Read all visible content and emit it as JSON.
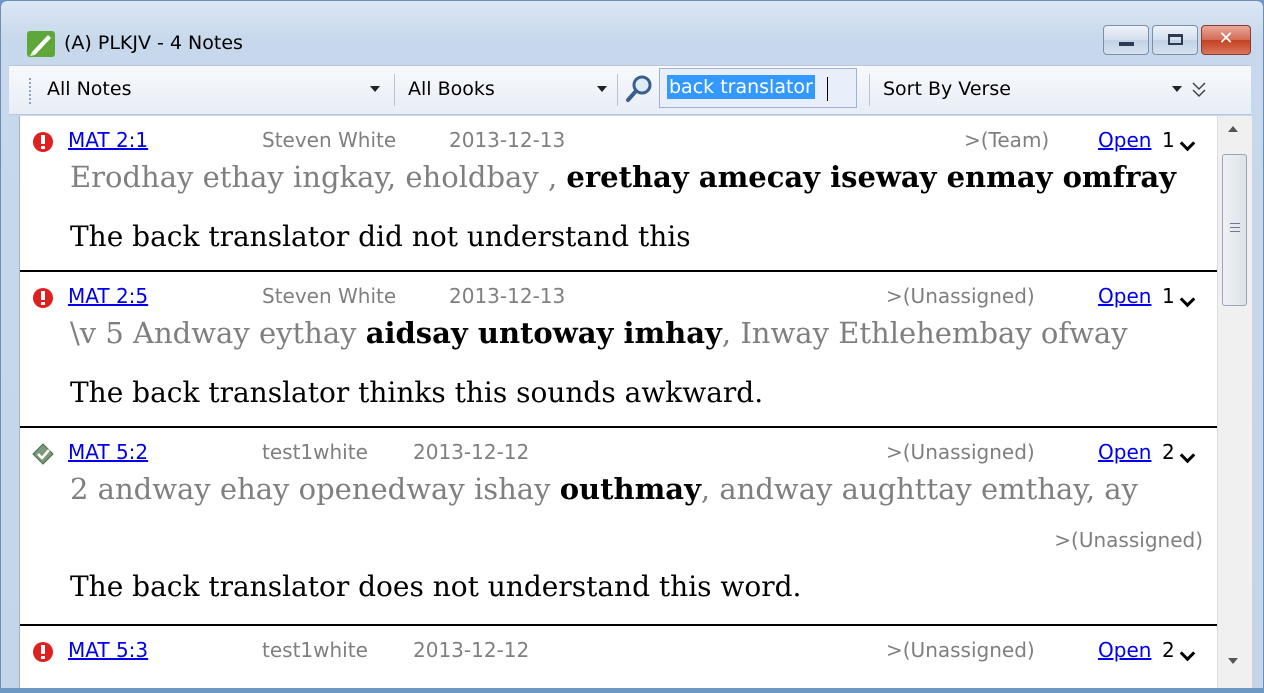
{
  "window": {
    "title": "(A) PLKJV - 4 Notes"
  },
  "toolbar": {
    "filter": "All Notes",
    "books": "All Books",
    "search_value": "back translator",
    "sort": "Sort By Verse"
  },
  "notes": [
    {
      "status": "alert",
      "ref": "MAT 2:1",
      "author": "Steven White",
      "date": "2013-12-13",
      "assigned": ">(Team)",
      "open": "Open",
      "count": "1",
      "verse_plain": "Erodhay ethay ingkay, eholdbay , ",
      "verse_bold": "erethay amecay iseway enmay omfray",
      "verse_after": "",
      "comment": "The back translator did not understand this"
    },
    {
      "status": "alert",
      "ref": "MAT 2:5",
      "author": "Steven White",
      "date": "2013-12-13",
      "assigned": ">(Unassigned)",
      "open": "Open",
      "count": "1",
      "verse_plain": "\\v 5 Andway eythay ",
      "verse_bold": "aidsay untoway imhay",
      "verse_after": ", Inway Ethlehembay ofway",
      "comment": "The back translator thinks this sounds awkward."
    },
    {
      "status": "resolved",
      "ref": "MAT 5:2",
      "author": "test1white",
      "date": "2013-12-12",
      "assigned": ">(Unassigned)",
      "open": "Open",
      "count": "2",
      "verse_plain": "2 andway ehay openedway ishay ",
      "verse_bold": "outhmay",
      "verse_after": ", andway aughttay emthay, ay",
      "sub_assigned": ">(Unassigned)",
      "comment": "The back translator does not understand this word."
    },
    {
      "status": "alert",
      "ref": "MAT 5:3",
      "author": "test1white",
      "date": "2013-12-12",
      "assigned": ">(Unassigned)",
      "open": "Open",
      "count": "2"
    }
  ],
  "icons": {
    "app": "pencil-leaf-icon",
    "alert": "exclamation-circle-icon",
    "resolved": "check-diamond-icon",
    "search": "magnifier-icon"
  },
  "colors": {
    "link": "#0000ee",
    "alert": "#e02020",
    "resolved": "#6a8f6a",
    "muted": "#7f7f7f"
  }
}
